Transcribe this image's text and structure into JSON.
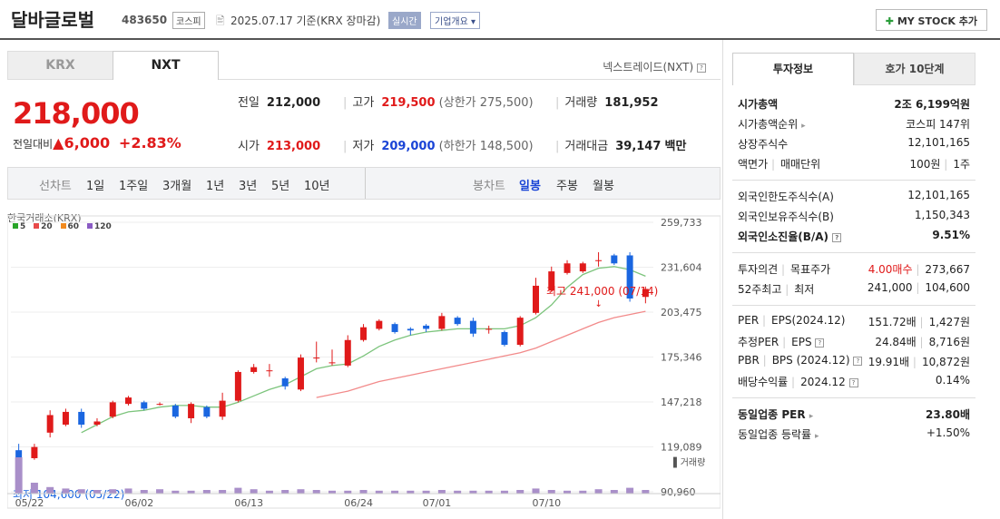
{
  "header": {
    "stock_name": "달바글로벌",
    "code": "483650",
    "market": "코스피",
    "date": "2025.07.17  기준(KRX 장마감)",
    "realtime": "실시간",
    "company_info": "기업개요",
    "mystock": "MY STOCK 추가"
  },
  "exchange_tabs": [
    "KRX",
    "NXT"
  ],
  "nextrade_label": "넥스트레이드(NXT)",
  "quote": {
    "price": "218,000",
    "change_label": "전일대비",
    "change_amount": "6,000",
    "change_pct": "+2.83%",
    "prev_close_label": "전일",
    "prev_close": "212,000",
    "high_label": "고가",
    "high": "219,500",
    "upper_limit": "(상한가 275,500)",
    "volume_label": "거래량",
    "volume": "181,952",
    "open_label": "시가",
    "open": "213,000",
    "low_label": "저가",
    "low": "209,000",
    "lower_limit": "(하한가 148,500)",
    "value_label": "거래대금",
    "value": "39,147",
    "value_unit": "백만"
  },
  "period_bar": {
    "line_label": "선차트",
    "line_periods": [
      "1일",
      "1주일",
      "3개월",
      "1년",
      "3년",
      "5년",
      "10년"
    ],
    "candle_label": "봉차트",
    "candle_periods": [
      "일봉",
      "주봉",
      "월봉"
    ],
    "selected_candle": "일봉"
  },
  "chart_data": {
    "type": "candlestick",
    "source_label": "한국거래소(KRX)",
    "legend": [
      {
        "name": "5",
        "color": "#2aa52a"
      },
      {
        "name": "20",
        "color": "#e84a4a"
      },
      {
        "name": "60",
        "color": "#f28a1e"
      },
      {
        "name": "120",
        "color": "#8a5bc4"
      }
    ],
    "y_ticks": [
      259733,
      231604,
      203475,
      175346,
      147218,
      119089,
      90960
    ],
    "y_tick_labels": [
      "259,733",
      "231,604",
      "203,475",
      "175,346",
      "147,218",
      "119,089",
      "90,960"
    ],
    "ylim": [
      90960,
      259733
    ],
    "x_labels": [
      {
        "idx": 0,
        "label": "05/22"
      },
      {
        "idx": 7,
        "label": "06/02"
      },
      {
        "idx": 14,
        "label": "06/13"
      },
      {
        "idx": 21,
        "label": "06/24"
      },
      {
        "idx": 26,
        "label": "07/01"
      },
      {
        "idx": 33,
        "label": "07/10"
      }
    ],
    "candles": [
      {
        "o": 117000,
        "c": 110000,
        "h": 121000,
        "l": 104600
      },
      {
        "o": 112000,
        "c": 119000,
        "h": 121000,
        "l": 111000
      },
      {
        "o": 128000,
        "c": 139000,
        "h": 142000,
        "l": 125000
      },
      {
        "o": 133000,
        "c": 141000,
        "h": 143000,
        "l": 132000
      },
      {
        "o": 141000,
        "c": 133000,
        "h": 143000,
        "l": 131000
      },
      {
        "o": 133000,
        "c": 135000,
        "h": 137000,
        "l": 132000
      },
      {
        "o": 138000,
        "c": 147000,
        "h": 148000,
        "l": 137000
      },
      {
        "o": 146000,
        "c": 150000,
        "h": 151000,
        "l": 145000
      },
      {
        "o": 147000,
        "c": 143000,
        "h": 148000,
        "l": 142000
      },
      {
        "o": 146000,
        "c": 146000,
        "h": 147000,
        "l": 145000
      },
      {
        "o": 145000,
        "c": 138000,
        "h": 146000,
        "l": 137000
      },
      {
        "o": 137000,
        "c": 146000,
        "h": 147000,
        "l": 134000
      },
      {
        "o": 144000,
        "c": 138000,
        "h": 145000,
        "l": 137000
      },
      {
        "o": 138000,
        "c": 148000,
        "h": 153000,
        "l": 136000
      },
      {
        "o": 148000,
        "c": 166000,
        "h": 167000,
        "l": 147000
      },
      {
        "o": 166000,
        "c": 169000,
        "h": 171000,
        "l": 165000
      },
      {
        "o": 167000,
        "c": 167000,
        "h": 171000,
        "l": 163000
      },
      {
        "o": 162000,
        "c": 157000,
        "h": 163000,
        "l": 155000
      },
      {
        "o": 155000,
        "c": 175000,
        "h": 177000,
        "l": 154000
      },
      {
        "o": 175000,
        "c": 175000,
        "h": 185000,
        "l": 172000
      },
      {
        "o": 172000,
        "c": 172000,
        "h": 180000,
        "l": 170000
      },
      {
        "o": 170000,
        "c": 186000,
        "h": 189000,
        "l": 169000
      },
      {
        "o": 186000,
        "c": 194000,
        "h": 196000,
        "l": 185000
      },
      {
        "o": 193000,
        "c": 198000,
        "h": 199000,
        "l": 192000
      },
      {
        "o": 196000,
        "c": 191000,
        "h": 197000,
        "l": 190000
      },
      {
        "o": 193000,
        "c": 192000,
        "h": 194000,
        "l": 189000
      },
      {
        "o": 195000,
        "c": 193000,
        "h": 196000,
        "l": 191000
      },
      {
        "o": 193000,
        "c": 201000,
        "h": 203000,
        "l": 192000
      },
      {
        "o": 200000,
        "c": 196000,
        "h": 201000,
        "l": 195000
      },
      {
        "o": 198000,
        "c": 190000,
        "h": 200000,
        "l": 188000
      },
      {
        "o": 193000,
        "c": 193000,
        "h": 195000,
        "l": 190000
      },
      {
        "o": 191000,
        "c": 183000,
        "h": 192000,
        "l": 182000
      },
      {
        "o": 183000,
        "c": 200000,
        "h": 201000,
        "l": 182000
      },
      {
        "o": 203000,
        "c": 220000,
        "h": 225000,
        "l": 202000
      },
      {
        "o": 217000,
        "c": 229000,
        "h": 232000,
        "l": 216000
      },
      {
        "o": 228000,
        "c": 234000,
        "h": 236000,
        "l": 227000
      },
      {
        "o": 229000,
        "c": 234000,
        "h": 235000,
        "l": 228000
      },
      {
        "o": 236000,
        "c": 236000,
        "h": 241000,
        "l": 232000
      },
      {
        "o": 239000,
        "c": 234000,
        "h": 240000,
        "l": 233000
      },
      {
        "o": 239000,
        "c": 212000,
        "h": 241000,
        "l": 210000
      },
      {
        "o": 213000,
        "c": 218000,
        "h": 219500,
        "l": 209000
      }
    ],
    "ma5": [
      null,
      null,
      null,
      null,
      128000,
      133000,
      138000,
      141000,
      142000,
      144000,
      145000,
      145000,
      144000,
      144000,
      147000,
      151000,
      155000,
      158000,
      163000,
      168000,
      170000,
      171000,
      176000,
      182000,
      186000,
      189000,
      191000,
      192000,
      193000,
      193000,
      193000,
      193000,
      195000,
      200000,
      208000,
      219000,
      227000,
      231000,
      232000,
      230000,
      226000
    ],
    "ma20": [
      null,
      null,
      null,
      null,
      null,
      null,
      null,
      null,
      null,
      null,
      null,
      null,
      null,
      null,
      null,
      null,
      null,
      null,
      null,
      150000,
      152000,
      154000,
      157000,
      160000,
      162000,
      164000,
      166000,
      168000,
      170000,
      172000,
      174000,
      176000,
      178000,
      181000,
      185000,
      189000,
      193000,
      197000,
      200000,
      202000,
      204000
    ],
    "annotations": {
      "high": "최고 241,000 (07/14)",
      "low": "최저 104,600 (05/22)"
    },
    "volume_label": "거래량",
    "volume": [
      100,
      30,
      18,
      14,
      12,
      10,
      12,
      14,
      10,
      12,
      8,
      8,
      10,
      10,
      16,
      12,
      8,
      10,
      12,
      10,
      8,
      8,
      10,
      8,
      8,
      8,
      8,
      10,
      8,
      8,
      8,
      8,
      10,
      14,
      10,
      8,
      8,
      12,
      10,
      16,
      10
    ]
  },
  "invest_tabs": [
    "투자정보",
    "호가 10단계"
  ],
  "invest": {
    "market_cap_label": "시가총액",
    "market_cap": "2조 6,199억원",
    "rank_label": "시가총액순위",
    "rank": "코스피 147위",
    "shares_label": "상장주식수",
    "shares": "12,101,165",
    "par_label": "액면가",
    "par_unit_label": "매매단위",
    "par": "100원",
    "par_unit": "1주",
    "foreign_limit_label": "외국인한도주식수(A)",
    "foreign_limit": "12,101,165",
    "foreign_hold_label": "외국인보유주식수(B)",
    "foreign_hold": "1,150,343",
    "foreign_ratio_label": "외국인소진율(B/A)",
    "foreign_ratio": "9.51%",
    "opinion_label": "투자의견",
    "target_label": "목표주가",
    "opinion": "4.00매수",
    "target": "273,667",
    "wk52_label": "52주최고",
    "wk52_low_label": "최저",
    "wk52_high": "241,000",
    "wk52_low": "104,600",
    "per_label": "PER",
    "eps_label": "EPS(2024.12)",
    "per": "151.72배",
    "eps": "1,427원",
    "eper_label": "추정PER",
    "eeps_label": "EPS",
    "eper": "24.84배",
    "eeps": "8,716원",
    "pbr_label": "PBR",
    "bps_label": "BPS (2024.12)",
    "pbr": "19.91배",
    "bps": "10,872원",
    "div_label": "배당수익률",
    "div_year": "2024.12",
    "div": "0.14%",
    "ind_per_label": "동일업종 PER",
    "ind_per": "23.80배",
    "ind_chg_label": "동일업종 등락률",
    "ind_chg": "+1.50%"
  }
}
